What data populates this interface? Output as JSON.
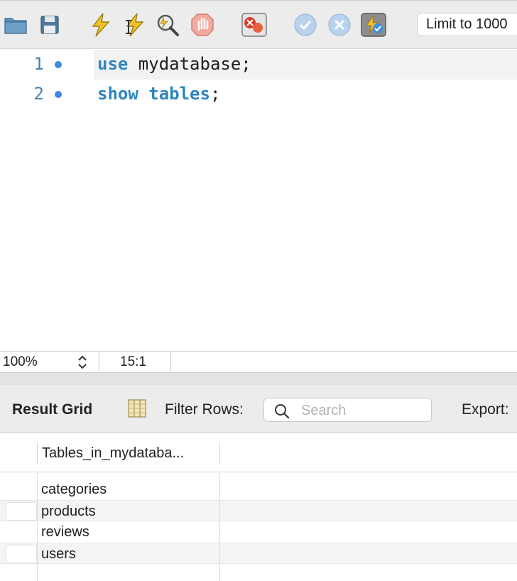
{
  "toolbar": {
    "buttons": [
      {
        "name": "open-folder-icon"
      },
      {
        "name": "save-icon"
      },
      {
        "name": "execute-all-lightning-icon"
      },
      {
        "name": "execute-current-lightning-icon"
      },
      {
        "name": "explain-magnifier-icon"
      },
      {
        "name": "stop-hand-icon"
      },
      {
        "name": "toggle-error-continue-icon"
      },
      {
        "name": "commit-check-icon"
      },
      {
        "name": "rollback-x-icon"
      },
      {
        "name": "autocommit-toggle-icon"
      }
    ],
    "limit_label": "Limit to 1000"
  },
  "editor": {
    "lines": [
      {
        "number": "1",
        "keyword": "use",
        "rest": " mydatabase;"
      },
      {
        "number": "2",
        "keyword": "show tables",
        "rest": ";"
      }
    ]
  },
  "status": {
    "zoom": "100%",
    "cursor_position": "15:1"
  },
  "result": {
    "title": "Result Grid",
    "filter_label": "Filter Rows:",
    "search_placeholder": "Search",
    "export_label": "Export:",
    "column_header": "Tables_in_mydataba...",
    "rows": [
      "categories",
      "products",
      "reviews",
      "users"
    ]
  },
  "colors": {
    "keyword": "#2f86bf",
    "line_number": "#4a7fb0",
    "breakpoint_dot": "#3e8ae0",
    "toolbar_bg": "#ececec"
  }
}
